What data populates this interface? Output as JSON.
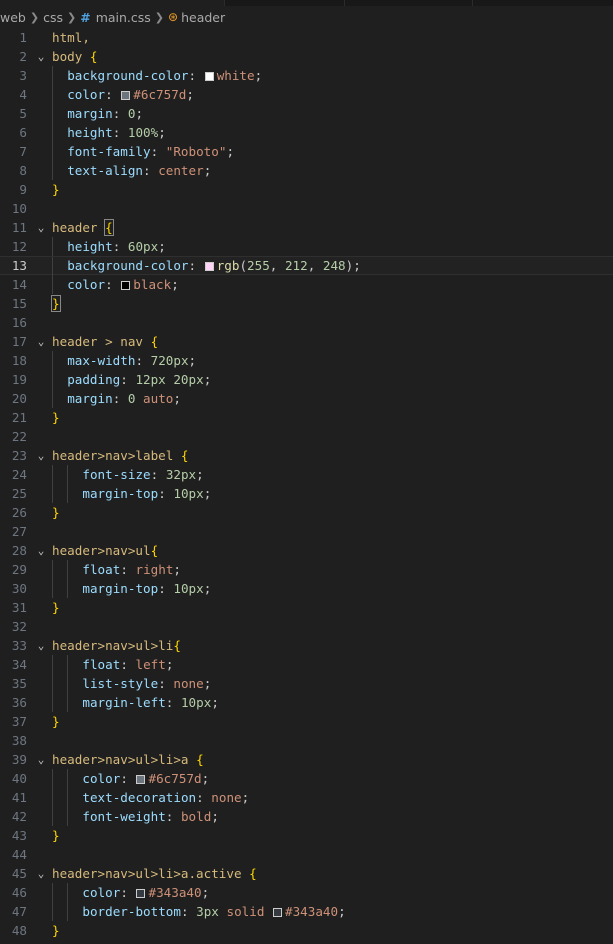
{
  "breadcrumb": {
    "items": [
      "web",
      "css",
      "main.css",
      "header"
    ],
    "file_icon": "css-hash-icon",
    "symbol_icon": "symbol-structure-icon"
  },
  "editor": {
    "current_line": 13,
    "lines": [
      {
        "n": "1",
        "fold": false,
        "indent": 0,
        "t": [
          [
            "html,",
            "sel"
          ]
        ]
      },
      {
        "n": "2",
        "fold": true,
        "indent": 0,
        "t": [
          [
            "body ",
            "sel"
          ],
          [
            "{",
            "brace"
          ]
        ]
      },
      {
        "n": "3",
        "fold": false,
        "indent": 1,
        "t": [
          [
            "background-color",
            "prop"
          ],
          [
            ": ",
            "colon"
          ],
          [
            "#ffffff",
            "sw"
          ],
          [
            "white",
            "val"
          ],
          [
            ";",
            "colon"
          ]
        ]
      },
      {
        "n": "4",
        "fold": false,
        "indent": 1,
        "t": [
          [
            "color",
            "prop"
          ],
          [
            ": ",
            "colon"
          ],
          [
            "#6c757d",
            "sw"
          ],
          [
            "#6c757d",
            "val"
          ],
          [
            ";",
            "colon"
          ]
        ]
      },
      {
        "n": "5",
        "fold": false,
        "indent": 1,
        "t": [
          [
            "margin",
            "prop"
          ],
          [
            ": ",
            "colon"
          ],
          [
            "0",
            "num"
          ],
          [
            ";",
            "colon"
          ]
        ]
      },
      {
        "n": "6",
        "fold": false,
        "indent": 1,
        "t": [
          [
            "height",
            "prop"
          ],
          [
            ": ",
            "colon"
          ],
          [
            "100%",
            "num"
          ],
          [
            ";",
            "colon"
          ]
        ]
      },
      {
        "n": "7",
        "fold": false,
        "indent": 1,
        "t": [
          [
            "font-family",
            "prop"
          ],
          [
            ": ",
            "colon"
          ],
          [
            "\"Roboto\"",
            "val"
          ],
          [
            ";",
            "colon"
          ]
        ]
      },
      {
        "n": "8",
        "fold": false,
        "indent": 1,
        "t": [
          [
            "text-align",
            "prop"
          ],
          [
            ": ",
            "colon"
          ],
          [
            "center",
            "val"
          ],
          [
            ";",
            "colon"
          ]
        ]
      },
      {
        "n": "9",
        "fold": false,
        "indent": 0,
        "t": [
          [
            "}",
            "brace"
          ]
        ]
      },
      {
        "n": "10",
        "fold": false,
        "indent": 0,
        "t": []
      },
      {
        "n": "11",
        "fold": true,
        "indent": 0,
        "t": [
          [
            "header ",
            "sel"
          ],
          [
            "{",
            "brace-m"
          ]
        ]
      },
      {
        "n": "12",
        "fold": false,
        "indent": 1,
        "t": [
          [
            "height",
            "prop"
          ],
          [
            ": ",
            "colon"
          ],
          [
            "60px",
            "num"
          ],
          [
            ";",
            "colon"
          ]
        ]
      },
      {
        "n": "13",
        "fold": false,
        "indent": 1,
        "t": [
          [
            "background-color",
            "prop"
          ],
          [
            ": ",
            "colon"
          ],
          [
            "#ffd4f8",
            "sw"
          ],
          [
            "rgb",
            "fn"
          ],
          [
            "(",
            "colon"
          ],
          [
            "255",
            "num"
          ],
          [
            ", ",
            "colon"
          ],
          [
            "212",
            "num"
          ],
          [
            ", ",
            "colon"
          ],
          [
            "248",
            "num"
          ],
          [
            ");",
            "colon"
          ]
        ]
      },
      {
        "n": "14",
        "fold": false,
        "indent": 1,
        "t": [
          [
            "color",
            "prop"
          ],
          [
            ": ",
            "colon"
          ],
          [
            "#000000",
            "sw"
          ],
          [
            "black",
            "val"
          ],
          [
            ";",
            "colon"
          ]
        ]
      },
      {
        "n": "15",
        "fold": false,
        "indent": 0,
        "t": [
          [
            "}",
            "brace-m"
          ]
        ]
      },
      {
        "n": "16",
        "fold": false,
        "indent": 0,
        "t": []
      },
      {
        "n": "17",
        "fold": true,
        "indent": 0,
        "t": [
          [
            "header > nav ",
            "sel"
          ],
          [
            "{",
            "brace"
          ]
        ]
      },
      {
        "n": "18",
        "fold": false,
        "indent": 1,
        "t": [
          [
            "max-width",
            "prop"
          ],
          [
            ": ",
            "colon"
          ],
          [
            "720px",
            "num"
          ],
          [
            ";",
            "colon"
          ]
        ]
      },
      {
        "n": "19",
        "fold": false,
        "indent": 1,
        "t": [
          [
            "padding",
            "prop"
          ],
          [
            ": ",
            "colon"
          ],
          [
            "12px 20px",
            "num"
          ],
          [
            ";",
            "colon"
          ]
        ]
      },
      {
        "n": "20",
        "fold": false,
        "indent": 1,
        "t": [
          [
            "margin",
            "prop"
          ],
          [
            ": ",
            "colon"
          ],
          [
            "0 ",
            "num"
          ],
          [
            "auto",
            "val"
          ],
          [
            ";",
            "colon"
          ]
        ]
      },
      {
        "n": "21",
        "fold": false,
        "indent": 0,
        "t": [
          [
            "}",
            "brace"
          ]
        ]
      },
      {
        "n": "22",
        "fold": false,
        "indent": 0,
        "t": []
      },
      {
        "n": "23",
        "fold": true,
        "indent": 0,
        "t": [
          [
            "header>nav>label ",
            "sel"
          ],
          [
            "{",
            "brace"
          ]
        ]
      },
      {
        "n": "24",
        "fold": false,
        "indent": 2,
        "t": [
          [
            "font-size",
            "prop"
          ],
          [
            ": ",
            "colon"
          ],
          [
            "32px",
            "num"
          ],
          [
            ";",
            "colon"
          ]
        ]
      },
      {
        "n": "25",
        "fold": false,
        "indent": 2,
        "t": [
          [
            "margin-top",
            "prop"
          ],
          [
            ": ",
            "colon"
          ],
          [
            "10px",
            "num"
          ],
          [
            ";",
            "colon"
          ]
        ]
      },
      {
        "n": "26",
        "fold": false,
        "indent": 0,
        "t": [
          [
            "}",
            "brace"
          ]
        ]
      },
      {
        "n": "27",
        "fold": false,
        "indent": 0,
        "t": []
      },
      {
        "n": "28",
        "fold": true,
        "indent": 0,
        "t": [
          [
            "header>nav>ul",
            "sel"
          ],
          [
            "{",
            "brace"
          ]
        ]
      },
      {
        "n": "29",
        "fold": false,
        "indent": 2,
        "t": [
          [
            "float",
            "prop"
          ],
          [
            ": ",
            "colon"
          ],
          [
            "right",
            "val"
          ],
          [
            ";",
            "colon"
          ]
        ]
      },
      {
        "n": "30",
        "fold": false,
        "indent": 2,
        "t": [
          [
            "margin-top",
            "prop"
          ],
          [
            ": ",
            "colon"
          ],
          [
            "10px",
            "num"
          ],
          [
            ";",
            "colon"
          ]
        ]
      },
      {
        "n": "31",
        "fold": false,
        "indent": 0,
        "t": [
          [
            "}",
            "brace"
          ]
        ]
      },
      {
        "n": "32",
        "fold": false,
        "indent": 0,
        "t": []
      },
      {
        "n": "33",
        "fold": true,
        "indent": 0,
        "t": [
          [
            "header>nav>ul>li",
            "sel"
          ],
          [
            "{",
            "brace"
          ]
        ]
      },
      {
        "n": "34",
        "fold": false,
        "indent": 2,
        "t": [
          [
            "float",
            "prop"
          ],
          [
            ": ",
            "colon"
          ],
          [
            "left",
            "val"
          ],
          [
            ";",
            "colon"
          ]
        ]
      },
      {
        "n": "35",
        "fold": false,
        "indent": 2,
        "t": [
          [
            "list-style",
            "prop"
          ],
          [
            ": ",
            "colon"
          ],
          [
            "none",
            "val"
          ],
          [
            ";",
            "colon"
          ]
        ]
      },
      {
        "n": "36",
        "fold": false,
        "indent": 2,
        "t": [
          [
            "margin-left",
            "prop"
          ],
          [
            ": ",
            "colon"
          ],
          [
            "10px",
            "num"
          ],
          [
            ";",
            "colon"
          ]
        ]
      },
      {
        "n": "37",
        "fold": false,
        "indent": 0,
        "t": [
          [
            "}",
            "brace"
          ]
        ]
      },
      {
        "n": "38",
        "fold": false,
        "indent": 0,
        "t": []
      },
      {
        "n": "39",
        "fold": true,
        "indent": 0,
        "t": [
          [
            "header>nav>ul>li>a ",
            "sel"
          ],
          [
            "{",
            "brace"
          ]
        ]
      },
      {
        "n": "40",
        "fold": false,
        "indent": 2,
        "t": [
          [
            "color",
            "prop"
          ],
          [
            ": ",
            "colon"
          ],
          [
            "#6c757d",
            "sw"
          ],
          [
            "#6c757d",
            "val"
          ],
          [
            ";",
            "colon"
          ]
        ]
      },
      {
        "n": "41",
        "fold": false,
        "indent": 2,
        "t": [
          [
            "text-decoration",
            "prop"
          ],
          [
            ": ",
            "colon"
          ],
          [
            "none",
            "val"
          ],
          [
            ";",
            "colon"
          ]
        ]
      },
      {
        "n": "42",
        "fold": false,
        "indent": 2,
        "t": [
          [
            "font-weight",
            "prop"
          ],
          [
            ": ",
            "colon"
          ],
          [
            "bold",
            "val"
          ],
          [
            ";",
            "colon"
          ]
        ]
      },
      {
        "n": "43",
        "fold": false,
        "indent": 0,
        "t": [
          [
            "}",
            "brace"
          ]
        ]
      },
      {
        "n": "44",
        "fold": false,
        "indent": 0,
        "t": []
      },
      {
        "n": "45",
        "fold": true,
        "indent": 0,
        "t": [
          [
            "header>nav>ul>li>a.active ",
            "sel"
          ],
          [
            "{",
            "brace"
          ]
        ]
      },
      {
        "n": "46",
        "fold": false,
        "indent": 2,
        "t": [
          [
            "color",
            "prop"
          ],
          [
            ": ",
            "colon"
          ],
          [
            "#343a40",
            "sw"
          ],
          [
            "#343a40",
            "val"
          ],
          [
            ";",
            "colon"
          ]
        ]
      },
      {
        "n": "47",
        "fold": false,
        "indent": 2,
        "t": [
          [
            "border-bottom",
            "prop"
          ],
          [
            ": ",
            "colon"
          ],
          [
            "3px ",
            "num"
          ],
          [
            "solid ",
            "val"
          ],
          [
            "#343a40",
            "sw"
          ],
          [
            "#343a40",
            "val"
          ],
          [
            ";",
            "colon"
          ]
        ]
      },
      {
        "n": "48",
        "fold": false,
        "indent": 0,
        "t": [
          [
            "}",
            "brace"
          ]
        ]
      }
    ]
  }
}
